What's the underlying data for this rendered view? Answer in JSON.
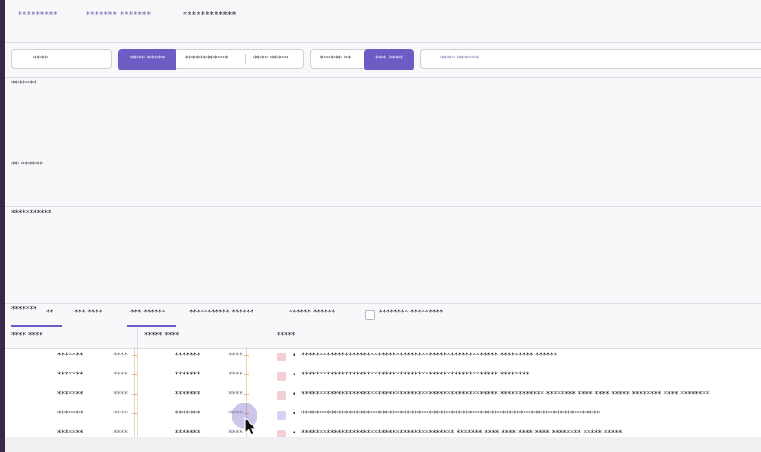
{
  "top_tabs": [
    "*********",
    "******* *******",
    "************"
  ],
  "toolbar": {
    "search_value": "****",
    "seg_group1": [
      "**** *****",
      "************",
      "**** *****"
    ],
    "seg_group2": [
      "****** **",
      "*** ****"
    ],
    "filter_placeholder": "**** ******"
  },
  "sections": {
    "first_title": "*******",
    "second_title": "** ******",
    "third_title": "***********"
  },
  "bottom_tabs": {
    "tab1": "*******",
    "tab1_count": "**",
    "tab2": "*** ****",
    "tab3": "*** ******",
    "tab4": "*********** ******",
    "tab5": "****** ******",
    "checkbox_label": "******** *********"
  },
  "table": {
    "headers": [
      "**** ****",
      "***** ****",
      "*****"
    ],
    "rows": [
      {
        "c1": "*******",
        "c1b": "****",
        "c2": "*******",
        "c2b": "****",
        "level": "error",
        "message": "****************************************************** ********* ******"
      },
      {
        "c1": "*******",
        "c1b": "****",
        "c2": "*******",
        "c2b": "****",
        "level": "error",
        "message": "****************************************************** ********"
      },
      {
        "c1": "*******",
        "c1b": "****",
        "c2": "*******",
        "c2b": "****",
        "level": "error",
        "message": "****************************************************** ************ ******** **** **** ***** ******** **** ********"
      },
      {
        "c1": "*******",
        "c1b": "****",
        "c2": "*******",
        "c2b": "****",
        "level": "info",
        "message": "**********************************************************************************"
      },
      {
        "c1": "*******",
        "c1b": "****",
        "c2": "*******",
        "c2b": "****",
        "level": "error",
        "message": "****************************************** ******* **** **** **** **** ******** ***** *****"
      }
    ]
  },
  "colors": {
    "accent": "#6c5cc4",
    "error_swatch": "#f1cfd2",
    "info_swatch": "#d6d2f3"
  }
}
